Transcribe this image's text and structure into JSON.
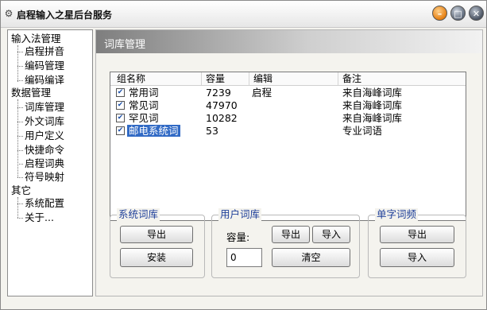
{
  "window": {
    "title": "启程输入之星后台服务",
    "icon": "gear-icon",
    "controls": [
      "minimize-icon",
      "maximize-icon",
      "close-icon"
    ]
  },
  "tree": {
    "groups": [
      {
        "label": "输入法管理",
        "items": [
          "启程拼音",
          "编码管理",
          "编码编译"
        ]
      },
      {
        "label": "数据管理",
        "items": [
          "词库管理",
          "外文词库",
          "用户定义",
          "快捷命令",
          "启程词典",
          "符号映射"
        ]
      },
      {
        "label": "其它",
        "items": [
          "系统配置",
          "关于..."
        ]
      }
    ]
  },
  "panel": {
    "title": "词库管理"
  },
  "wordlist": {
    "columns": [
      "组名称",
      "容量",
      "编辑",
      "备注"
    ],
    "rows": [
      {
        "checked": "✔",
        "name": "常用词",
        "size": "7239",
        "edit": "启程",
        "note": "来自海峰词库"
      },
      {
        "checked": "✔",
        "name": "常见词",
        "size": "47970",
        "edit": "",
        "note": "来自海峰词库"
      },
      {
        "checked": "✔",
        "name": "罕见词",
        "size": "10282",
        "edit": "",
        "note": "来自海峰词库"
      },
      {
        "checked": "✔",
        "name": "邮电系统词",
        "size": "53",
        "edit": "",
        "note": "专业词语"
      }
    ]
  },
  "system_lexicon": {
    "label": "系统词库",
    "export_label": "导出",
    "install_label": "安装"
  },
  "user_lexicon": {
    "label": "用户词库",
    "capacity_label": "容量:",
    "export_label": "导出",
    "import_label": "导入",
    "capacity_value": "0",
    "clear_label": "清空"
  },
  "single_char": {
    "label": "单字词频",
    "export_label": "导出",
    "import_label": "导入"
  },
  "colors": {
    "accent": "#1e3f99",
    "selection": "#316ac5"
  }
}
